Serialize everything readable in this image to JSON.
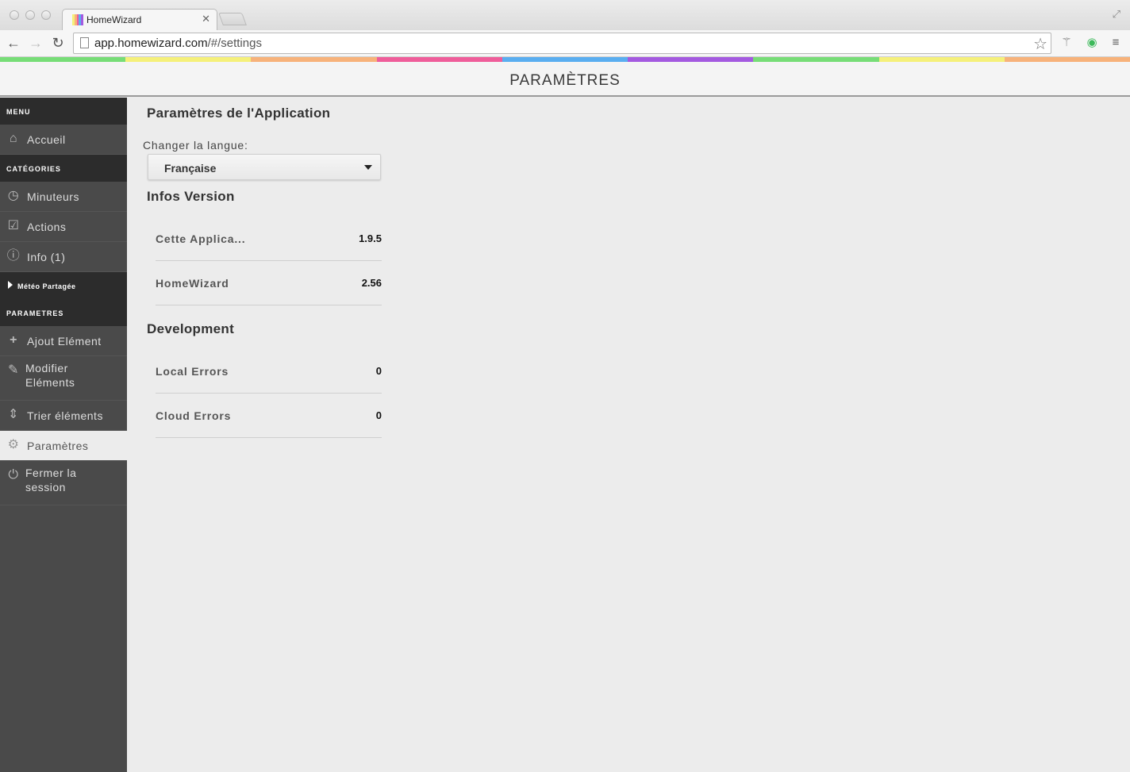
{
  "browser": {
    "tab_title": "HomeWizard",
    "url_host": "app.homewizard.com",
    "url_path": "/#/settings",
    "strip_colors": [
      "#77dd77",
      "#f5f07a",
      "#f7b27a",
      "#ef5d9a",
      "#5aaef0",
      "#a45ae0",
      "#77dd77",
      "#f5f07a",
      "#f7b27a"
    ]
  },
  "header": {
    "title": "PARAMÈTRES"
  },
  "sidebar": {
    "menu_header": "MENU",
    "home": "Accueil",
    "categories_header": "CATÉGORIES",
    "categories": [
      {
        "label": "Minuteurs",
        "icon": "clock-icon"
      },
      {
        "label": "Actions",
        "icon": "checkbox-icon"
      },
      {
        "label": "Info (1)",
        "icon": "info-icon"
      }
    ],
    "shared_weather": "Météo Partagée",
    "settings_header": "PARAMETRES",
    "settings_items": [
      {
        "label": "Ajout Elément",
        "icon": "plus-icon"
      },
      {
        "label": "Modifier Eléments",
        "icon": "pencil-icon"
      },
      {
        "label": "Trier éléments",
        "icon": "sort-icon"
      },
      {
        "label": "Paramètres",
        "icon": "gear-icon"
      },
      {
        "label": "Fermer la session",
        "icon": "power-icon"
      }
    ]
  },
  "main": {
    "app_settings_title": "Paramètres de l'Application",
    "lang_label": "Changer la langue:",
    "lang_value": "Française",
    "version_title": "Infos Version",
    "version_rows": [
      {
        "key": "Cette Applica...",
        "value": "1.9.5"
      },
      {
        "key": "HomeWizard",
        "value": "2.56"
      }
    ],
    "dev_title": "Development",
    "dev_rows": [
      {
        "key": "Local Errors",
        "value": "0"
      },
      {
        "key": "Cloud Errors",
        "value": "0"
      }
    ]
  }
}
